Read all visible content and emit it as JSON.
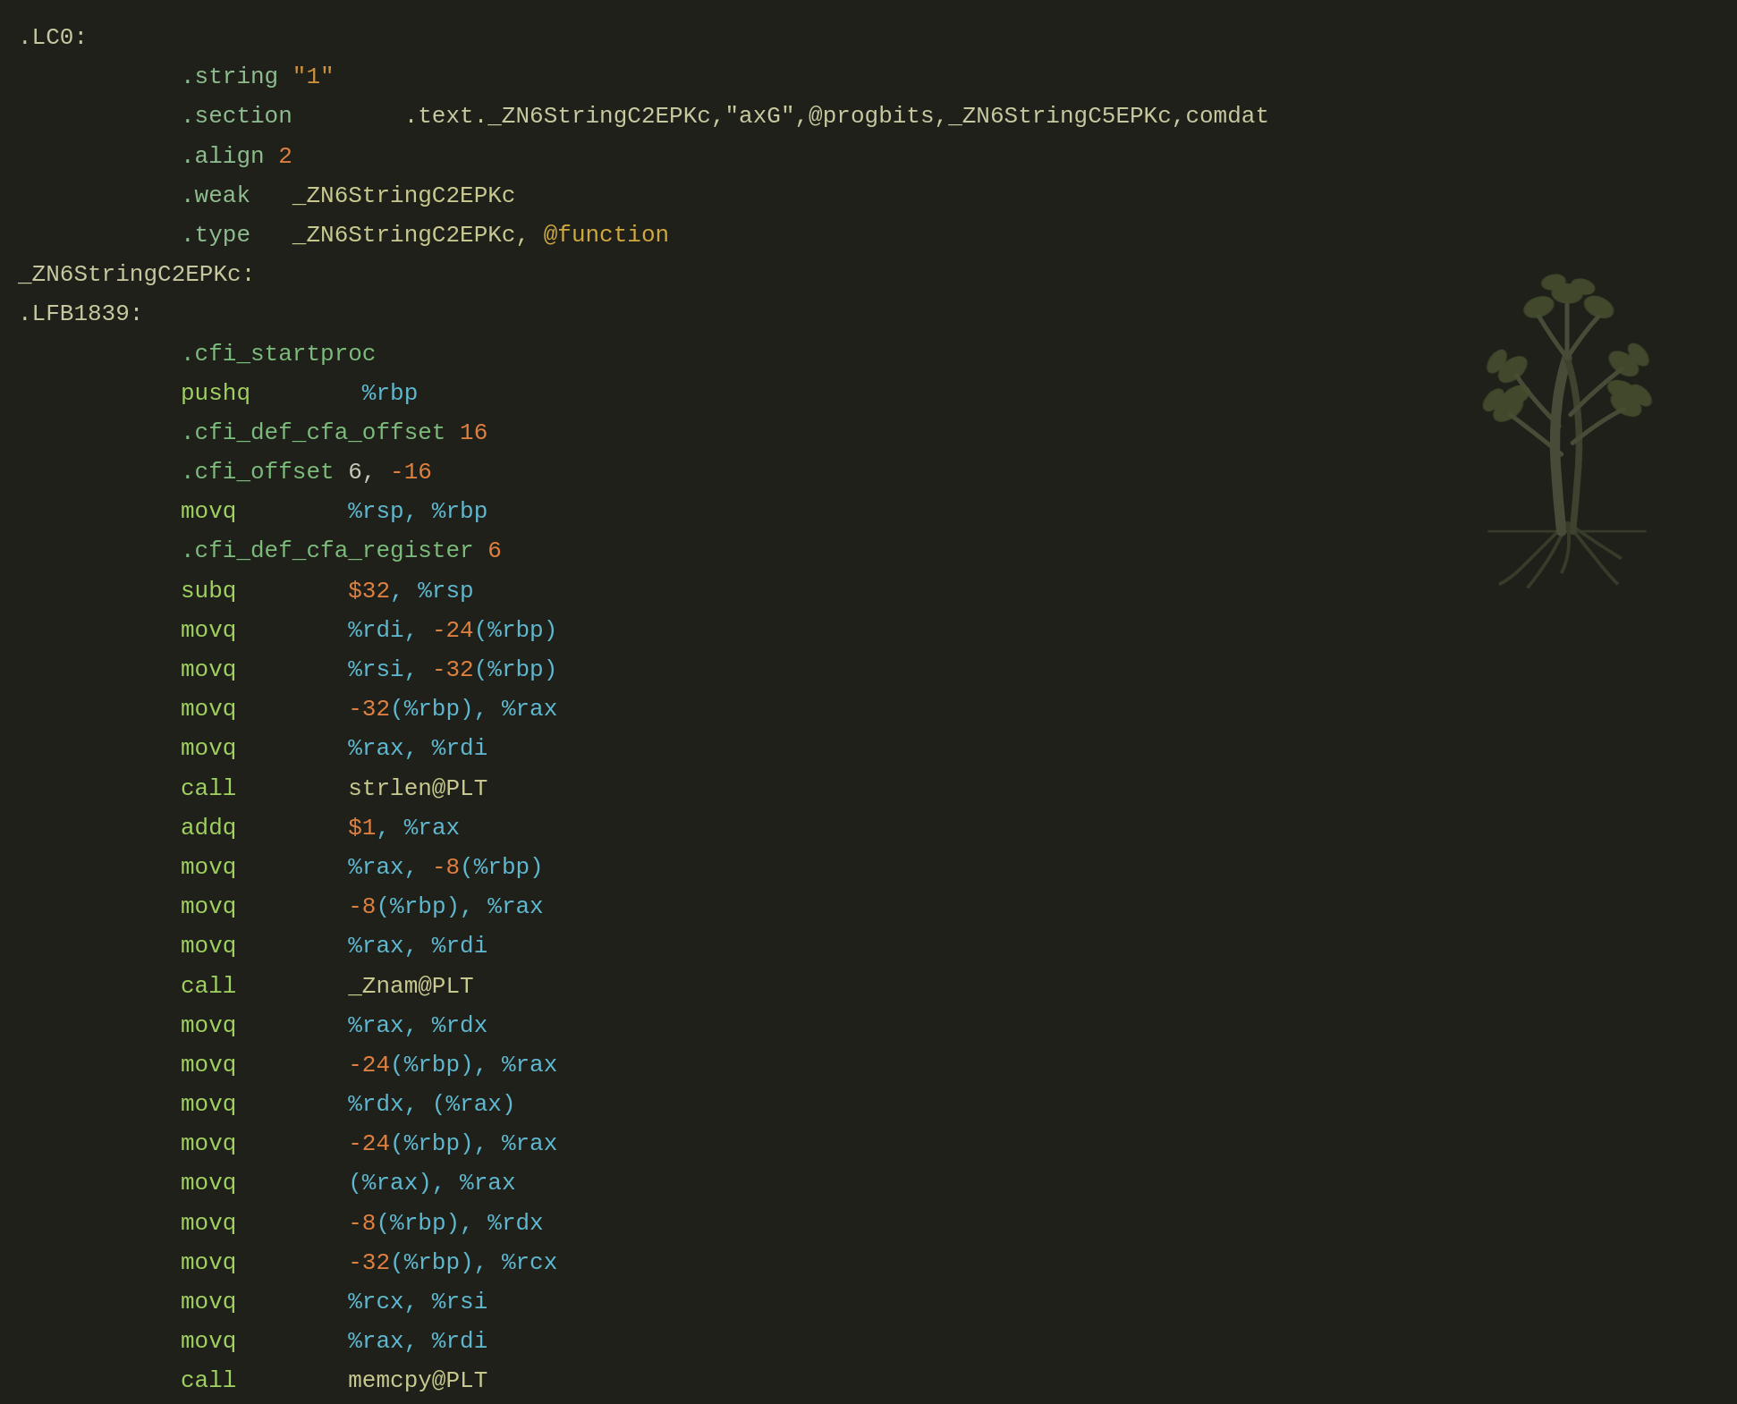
{
  "code": {
    "lines": [
      {
        "id": "lc0-label",
        "parts": [
          {
            "text": ".LC0:",
            "cls": "col-label"
          }
        ]
      },
      {
        "id": "string-dir",
        "indent": true,
        "parts": [
          {
            "text": ".string",
            "cls": "col-directive"
          },
          {
            "text": " ",
            "cls": ""
          },
          {
            "text": "\"1\"",
            "cls": "col-string"
          }
        ]
      },
      {
        "id": "section-dir",
        "indent": true,
        "parts": [
          {
            "text": ".section",
            "cls": "col-directive"
          },
          {
            "text": "        .text._ZN6StringC2EPKc,\"axG\",@progbits,_ZN6StringC5EPKc,comdat",
            "cls": "col-section-val"
          }
        ]
      },
      {
        "id": "align-dir",
        "indent": true,
        "parts": [
          {
            "text": ".align",
            "cls": "col-directive"
          },
          {
            "text": " ",
            "cls": ""
          },
          {
            "text": "2",
            "cls": "col-num"
          }
        ]
      },
      {
        "id": "weak-dir",
        "indent": true,
        "parts": [
          {
            "text": ".weak",
            "cls": "col-directive"
          },
          {
            "text": "   _ZN6StringC2EPKc",
            "cls": "col-sym"
          }
        ]
      },
      {
        "id": "type-dir",
        "indent": true,
        "parts": [
          {
            "text": ".type",
            "cls": "col-directive"
          },
          {
            "text": "   _ZN6StringC2EPKc, ",
            "cls": "col-sym"
          },
          {
            "text": "@function",
            "cls": "col-func"
          }
        ]
      },
      {
        "id": "zn6-label",
        "parts": [
          {
            "text": "_ZN6StringC2EPKc:",
            "cls": "col-label"
          }
        ]
      },
      {
        "id": "lfb-label",
        "parts": [
          {
            "text": ".LFB1839:",
            "cls": "col-label"
          }
        ]
      },
      {
        "id": "cfi-start",
        "indent": true,
        "parts": [
          {
            "text": ".cfi_startproc",
            "cls": "col-cfi"
          }
        ]
      },
      {
        "id": "pushq",
        "indent": true,
        "parts": [
          {
            "text": "pushq",
            "cls": "col-mnemonic"
          },
          {
            "text": "\t%rbp",
            "cls": "col-reg"
          }
        ]
      },
      {
        "id": "cfi-def-cfa",
        "indent": true,
        "parts": [
          {
            "text": ".cfi_def_cfa_offset",
            "cls": "col-cfi"
          },
          {
            "text": " ",
            "cls": ""
          },
          {
            "text": "16",
            "cls": "col-num"
          }
        ]
      },
      {
        "id": "cfi-offset",
        "indent": true,
        "parts": [
          {
            "text": ".cfi_offset",
            "cls": "col-cfi"
          },
          {
            "text": " 6, ",
            "cls": "col-plain"
          },
          {
            "text": "-16",
            "cls": "col-num"
          }
        ]
      },
      {
        "id": "movq-1",
        "indent": true,
        "parts": [
          {
            "text": "movq",
            "cls": "col-mnemonic"
          },
          {
            "text": "\t%rsp, %rbp",
            "cls": "col-reg"
          }
        ]
      },
      {
        "id": "cfi-def-reg",
        "indent": true,
        "parts": [
          {
            "text": ".cfi_def_cfa_register",
            "cls": "col-cfi"
          },
          {
            "text": " ",
            "cls": ""
          },
          {
            "text": "6",
            "cls": "col-num"
          }
        ]
      },
      {
        "id": "subq",
        "indent": true,
        "parts": [
          {
            "text": "subq",
            "cls": "col-mnemonic"
          },
          {
            "text": "\t",
            "cls": ""
          },
          {
            "text": "$32",
            "cls": "col-imm"
          },
          {
            "text": ", %rsp",
            "cls": "col-reg"
          }
        ]
      },
      {
        "id": "movq-2",
        "indent": true,
        "parts": [
          {
            "text": "movq",
            "cls": "col-mnemonic"
          },
          {
            "text": "\t%rdi, ",
            "cls": "col-reg"
          },
          {
            "text": "-24",
            "cls": "col-imm"
          },
          {
            "text": "(%rbp)",
            "cls": "col-reg"
          }
        ]
      },
      {
        "id": "movq-3",
        "indent": true,
        "parts": [
          {
            "text": "movq",
            "cls": "col-mnemonic"
          },
          {
            "text": "\t%rsi, ",
            "cls": "col-reg"
          },
          {
            "text": "-32",
            "cls": "col-imm"
          },
          {
            "text": "(%rbp)",
            "cls": "col-reg"
          }
        ]
      },
      {
        "id": "movq-4",
        "indent": true,
        "parts": [
          {
            "text": "movq",
            "cls": "col-mnemonic"
          },
          {
            "text": "\t",
            "cls": ""
          },
          {
            "text": "-32",
            "cls": "col-imm"
          },
          {
            "text": "(%rbp), %rax",
            "cls": "col-reg"
          }
        ]
      },
      {
        "id": "movq-5",
        "indent": true,
        "parts": [
          {
            "text": "movq",
            "cls": "col-mnemonic"
          },
          {
            "text": "\t%rax, %rdi",
            "cls": "col-reg"
          }
        ]
      },
      {
        "id": "call-strlen",
        "indent": true,
        "parts": [
          {
            "text": "call",
            "cls": "col-mnemonic"
          },
          {
            "text": "\tstrlen@PLT",
            "cls": "col-sym"
          }
        ]
      },
      {
        "id": "addq",
        "indent": true,
        "parts": [
          {
            "text": "addq",
            "cls": "col-mnemonic"
          },
          {
            "text": "\t",
            "cls": ""
          },
          {
            "text": "$1",
            "cls": "col-imm"
          },
          {
            "text": ", %rax",
            "cls": "col-reg"
          }
        ]
      },
      {
        "id": "movq-6",
        "indent": true,
        "parts": [
          {
            "text": "movq",
            "cls": "col-mnemonic"
          },
          {
            "text": "\t%rax, ",
            "cls": "col-reg"
          },
          {
            "text": "-8",
            "cls": "col-imm"
          },
          {
            "text": "(%rbp)",
            "cls": "col-reg"
          }
        ]
      },
      {
        "id": "movq-7",
        "indent": true,
        "parts": [
          {
            "text": "movq",
            "cls": "col-mnemonic"
          },
          {
            "text": "\t",
            "cls": ""
          },
          {
            "text": "-8",
            "cls": "col-imm"
          },
          {
            "text": "(%rbp), %rax",
            "cls": "col-reg"
          }
        ]
      },
      {
        "id": "movq-8",
        "indent": true,
        "parts": [
          {
            "text": "movq",
            "cls": "col-mnemonic"
          },
          {
            "text": "\t%rax, %rdi",
            "cls": "col-reg"
          }
        ]
      },
      {
        "id": "call-znam",
        "indent": true,
        "parts": [
          {
            "text": "call",
            "cls": "col-mnemonic"
          },
          {
            "text": "\t_Znam@PLT",
            "cls": "col-sym"
          }
        ]
      },
      {
        "id": "movq-9",
        "indent": true,
        "parts": [
          {
            "text": "movq",
            "cls": "col-mnemonic"
          },
          {
            "text": "\t%rax, %rdx",
            "cls": "col-reg"
          }
        ]
      },
      {
        "id": "movq-10",
        "indent": true,
        "parts": [
          {
            "text": "movq",
            "cls": "col-mnemonic"
          },
          {
            "text": "\t",
            "cls": ""
          },
          {
            "text": "-24",
            "cls": "col-imm"
          },
          {
            "text": "(%rbp), %rax",
            "cls": "col-reg"
          }
        ]
      },
      {
        "id": "movq-11",
        "indent": true,
        "parts": [
          {
            "text": "movq",
            "cls": "col-mnemonic"
          },
          {
            "text": "\t%rdx, (%rax)",
            "cls": "col-reg"
          }
        ]
      },
      {
        "id": "movq-12",
        "indent": true,
        "parts": [
          {
            "text": "movq",
            "cls": "col-mnemonic"
          },
          {
            "text": "\t",
            "cls": ""
          },
          {
            "text": "-24",
            "cls": "col-imm"
          },
          {
            "text": "(%rbp), %rax",
            "cls": "col-reg"
          }
        ]
      },
      {
        "id": "movq-13",
        "indent": true,
        "parts": [
          {
            "text": "movq",
            "cls": "col-mnemonic"
          },
          {
            "text": "\t(%rax), %rax",
            "cls": "col-reg"
          }
        ]
      },
      {
        "id": "movq-14",
        "indent": true,
        "parts": [
          {
            "text": "movq",
            "cls": "col-mnemonic"
          },
          {
            "text": "\t",
            "cls": ""
          },
          {
            "text": "-8",
            "cls": "col-imm"
          },
          {
            "text": "(%rbp), %rdx",
            "cls": "col-reg"
          }
        ]
      },
      {
        "id": "movq-15",
        "indent": true,
        "parts": [
          {
            "text": "movq",
            "cls": "col-mnemonic"
          },
          {
            "text": "\t",
            "cls": ""
          },
          {
            "text": "-32",
            "cls": "col-imm"
          },
          {
            "text": "(%rbp), %rcx",
            "cls": "col-reg"
          }
        ]
      },
      {
        "id": "movq-16",
        "indent": true,
        "parts": [
          {
            "text": "movq",
            "cls": "col-mnemonic"
          },
          {
            "text": "\t%rcx, %rsi",
            "cls": "col-reg"
          }
        ]
      },
      {
        "id": "movq-17",
        "indent": true,
        "parts": [
          {
            "text": "movq",
            "cls": "col-mnemonic"
          },
          {
            "text": "\t%rax, %rdi",
            "cls": "col-reg"
          }
        ]
      },
      {
        "id": "call-memcpy",
        "indent": true,
        "parts": [
          {
            "text": "call",
            "cls": "col-mnemonic"
          },
          {
            "text": "\tmemcpy@PLT",
            "cls": "col-sym"
          }
        ]
      }
    ]
  }
}
